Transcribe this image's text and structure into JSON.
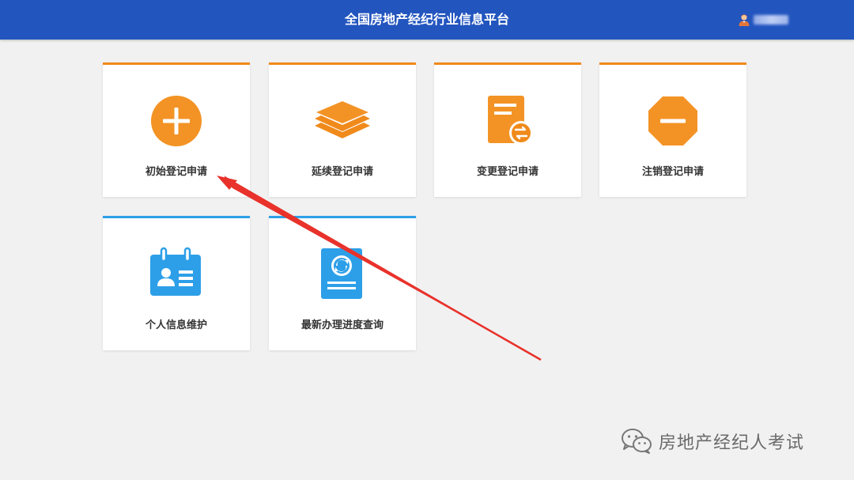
{
  "header": {
    "title": "全国房地产经纪行业信息平台",
    "user_icon": "user-avatar-icon"
  },
  "cards": [
    {
      "label": "初始登记申请",
      "icon": "plus-circle-icon",
      "accent": "#f08a1b"
    },
    {
      "label": "延续登记申请",
      "icon": "layers-icon",
      "accent": "#f08a1b"
    },
    {
      "label": "变更登记申请",
      "icon": "document-exchange-icon",
      "accent": "#f08a1b"
    },
    {
      "label": "注销登记申请",
      "icon": "octagon-minus-icon",
      "accent": "#f08a1b"
    },
    {
      "label": "个人信息维护",
      "icon": "id-card-icon",
      "accent": "#2d9fe8"
    },
    {
      "label": "最新办理进度查询",
      "icon": "document-refresh-icon",
      "accent": "#2d9fe8"
    }
  ],
  "watermark": {
    "text": "房地产经纪人考试",
    "icon": "wechat-icon"
  },
  "colors": {
    "header_bg": "#2355bf",
    "orange": "#f08a1b",
    "blue": "#2d9fe8",
    "annotation_arrow": "#e8322b"
  }
}
